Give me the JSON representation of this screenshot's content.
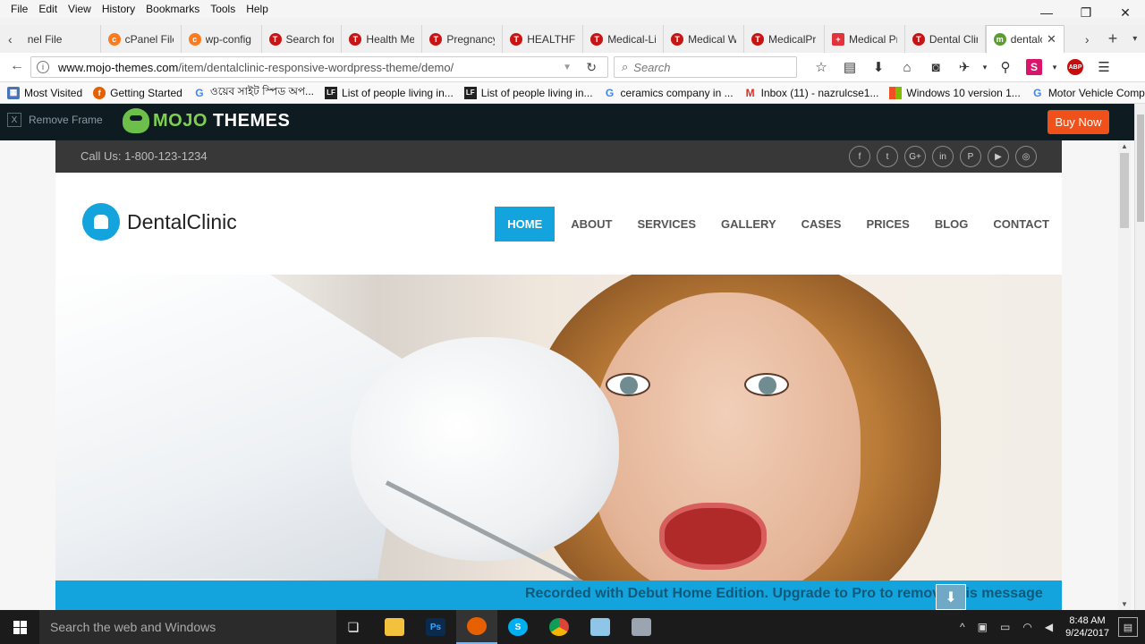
{
  "menubar": {
    "items": [
      "File",
      "Edit",
      "View",
      "History",
      "Bookmarks",
      "Tools",
      "Help"
    ]
  },
  "window_controls": {
    "minimize": "—",
    "maximize": "❐",
    "close": "✕"
  },
  "tabs": [
    {
      "label": "nel File",
      "icon": "cpanel-icon"
    },
    {
      "label": "cPanel File",
      "icon": "cpanel-icon"
    },
    {
      "label": "wp-config",
      "icon": "cpanel-icon"
    },
    {
      "label": "Search for",
      "icon": "theme-icon"
    },
    {
      "label": "Health Me",
      "icon": "theme-icon"
    },
    {
      "label": "Pregnancy",
      "icon": "theme-icon"
    },
    {
      "label": "HEALTHFL",
      "icon": "theme-icon"
    },
    {
      "label": "Medical-Li",
      "icon": "theme-icon"
    },
    {
      "label": "Medical W",
      "icon": "theme-icon"
    },
    {
      "label": "MedicalPr",
      "icon": "theme-icon"
    },
    {
      "label": "Medical Pr",
      "icon": "medical-cross-icon"
    },
    {
      "label": "Dental Clin",
      "icon": "theme-icon"
    },
    {
      "label": "dentalc",
      "icon": "mojo-icon",
      "active": true
    }
  ],
  "navbar": {
    "url_domain": "www.mojo-themes.com",
    "url_path": "/item/dentalclinic-responsive-wordpress-theme/demo/",
    "search_placeholder": "Search"
  },
  "bookmarks": [
    {
      "label": "Most Visited",
      "icon": "most-visited-icon"
    },
    {
      "label": "Getting Started",
      "icon": "firefox-icon"
    },
    {
      "label": "ওয়েব সাইট স্পিড অপ...",
      "icon": "google-icon"
    },
    {
      "label": "List of people living in...",
      "icon": "lf-icon"
    },
    {
      "label": "List of people living in...",
      "icon": "lf-icon"
    },
    {
      "label": "ceramics company in ...",
      "icon": "google-icon"
    },
    {
      "label": "Inbox (11) - nazrulcse1...",
      "icon": "gmail-icon"
    },
    {
      "label": "Windows 10 version 1...",
      "icon": "windows-icon"
    },
    {
      "label": "Motor Vehicle Compa...",
      "icon": "google-icon"
    }
  ],
  "mojo_bar": {
    "remove_frame": "Remove Frame",
    "remove_x": "X",
    "logo_text_a": "MOJO",
    "logo_text_b": " THEMES",
    "buy_now": "Buy Now"
  },
  "site": {
    "call_us": "Call Us: 1-800-123-1234",
    "social": [
      "f",
      "t",
      "G+",
      "in",
      "P",
      "▶",
      "◎"
    ],
    "brand": "DentalClinic",
    "nav": [
      "HOME",
      "ABOUT",
      "SERVICES",
      "GALLERY",
      "CASES",
      "PRICES",
      "BLOG",
      "CONTACT"
    ],
    "banner_overlay": "Recorded with Debut Home Edition. Upgrade to Pro to remove this message"
  },
  "taskbar": {
    "search_placeholder": "Search the web and Windows",
    "time": "8:48 AM",
    "date": "9/24/2017"
  },
  "colors": {
    "accent": "#13a4dd",
    "buy_now": "#f0501a",
    "mojo_bar": "#0e1c22",
    "topbar": "#383838"
  }
}
